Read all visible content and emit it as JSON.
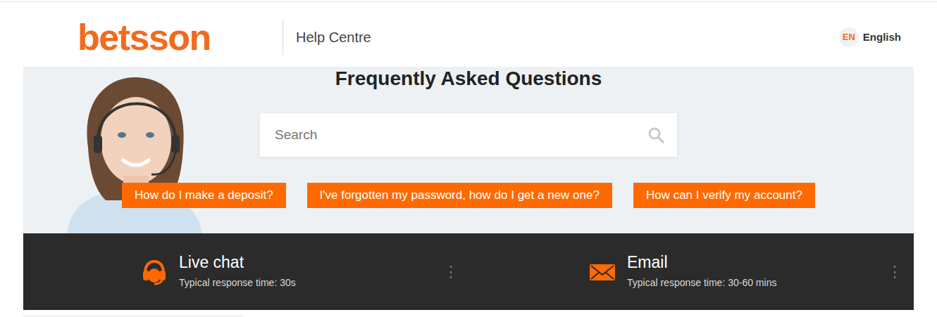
{
  "header": {
    "logo": "betsson",
    "section": "Help Centre",
    "language": {
      "code": "EN",
      "label": "English"
    }
  },
  "hero": {
    "title": "Frequently Asked Questions",
    "search": {
      "placeholder": "Search"
    },
    "quick_links": [
      "How do I make a deposit?",
      "I've forgotten my password, how do I get a new one?",
      "How can I verify my account?"
    ]
  },
  "contact": [
    {
      "kind": "chat",
      "label": "Live chat",
      "response": "Typical response time: 30s",
      "menu": "⋮"
    },
    {
      "kind": "email",
      "label": "Email",
      "response": "Typical response time: 30-60 mins",
      "menu": "⋮"
    }
  ]
}
